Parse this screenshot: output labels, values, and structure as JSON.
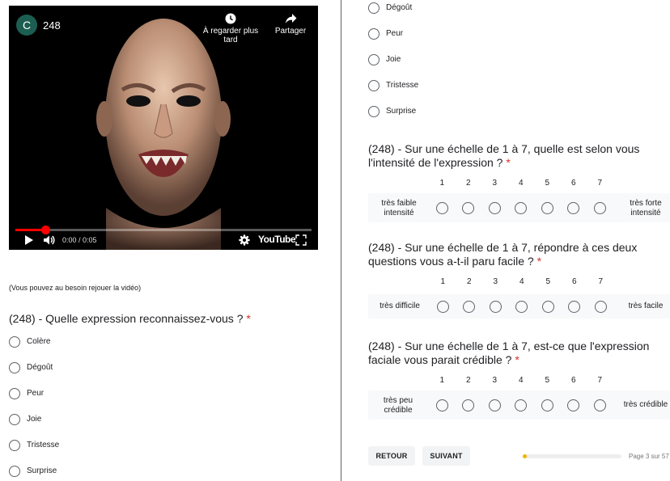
{
  "video": {
    "channel_initial": "C",
    "title": "248",
    "watch_later": "À regarder plus tard",
    "share": "Partager",
    "time": "0:00 / 0:05",
    "progress": 0.1,
    "logo": "YouTube",
    "icons": [
      "play-icon",
      "volume-icon",
      "gear-icon",
      "fullscreen-icon",
      "clock-icon",
      "share-arrow-icon"
    ]
  },
  "replay_note": "(Vous pouvez au besoin rejouer la vidéo)",
  "question_expression": {
    "title": "(248) - Quelle expression reconnaissez-vous ?",
    "required_mark": "*",
    "options": [
      "Colère",
      "Dégoût",
      "Peur",
      "Joie",
      "Tristesse",
      "Surprise"
    ]
  },
  "question_expression_repeat": {
    "options": [
      "Dégoût",
      "Peur",
      "Joie",
      "Tristesse",
      "Surprise"
    ]
  },
  "scale_questions": [
    {
      "title": "(248) - Sur une échelle de 1 à 7, quelle est selon vous l'intensité de l'expression ?",
      "required_mark": "*",
      "numbers": [
        "1",
        "2",
        "3",
        "4",
        "5",
        "6",
        "7"
      ],
      "low_label": "très faible intensité",
      "high_label": "très forte intensité"
    },
    {
      "title": "(248) - Sur une échelle de 1 à 7, répondre à ces deux questions vous a-t-il paru facile ?",
      "required_mark": "*",
      "numbers": [
        "1",
        "2",
        "3",
        "4",
        "5",
        "6",
        "7"
      ],
      "low_label": "très difficile",
      "high_label": "très facile"
    },
    {
      "title": "(248) - Sur une échelle de 1 à 7, est-ce que l'expression faciale vous parait crédible ?",
      "required_mark": "*",
      "numbers": [
        "1",
        "2",
        "3",
        "4",
        "5",
        "6",
        "7"
      ],
      "low_label": "très peu crédible",
      "high_label": "très crédible"
    }
  ],
  "navigation": {
    "back_label": "RETOUR",
    "next_label": "SUIVANT",
    "page_indicator": "Page 3 sur 57",
    "progress": 0.04
  },
  "colors": {
    "required": "#d93025",
    "progress_yellow": "#f4b400",
    "youtube_red": "#ff0000",
    "avatar_green": "#1c5e52"
  }
}
